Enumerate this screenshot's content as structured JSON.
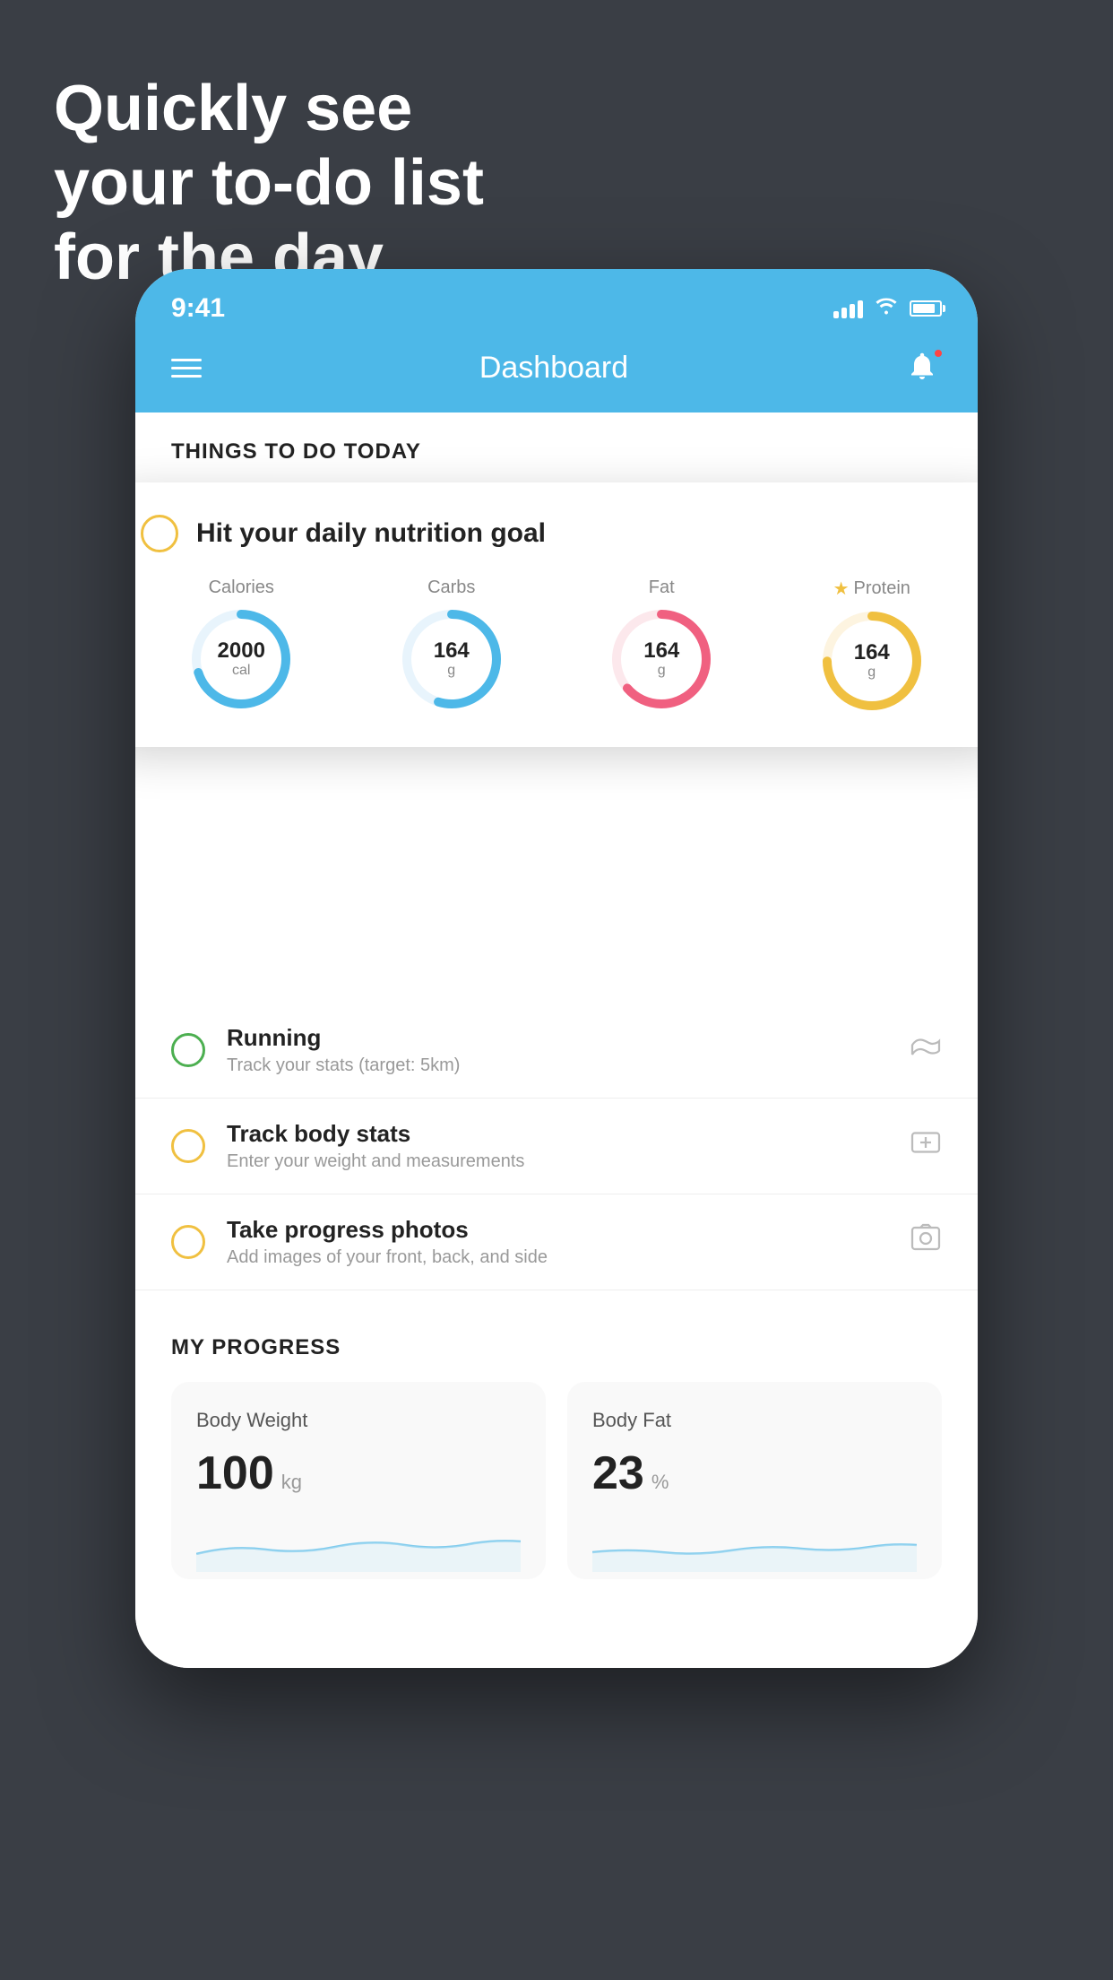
{
  "background": {
    "color": "#3a3e45"
  },
  "hero": {
    "line1": "Quickly see",
    "line2": "your to-do list",
    "line3": "for the day."
  },
  "phone": {
    "status_bar": {
      "time": "9:41",
      "signal": "signal-icon",
      "wifi": "wifi-icon",
      "battery": "battery-icon"
    },
    "header": {
      "menu_label": "menu-icon",
      "title": "Dashboard",
      "bell_label": "bell-icon"
    },
    "things_section": {
      "heading": "THINGS TO DO TODAY"
    },
    "floating_card": {
      "circle_color": "#f0c040",
      "title": "Hit your daily nutrition goal",
      "nutrition": [
        {
          "label": "Calories",
          "value": "2000",
          "unit": "cal",
          "color": "#4db8e8",
          "progress": 70,
          "starred": false
        },
        {
          "label": "Carbs",
          "value": "164",
          "unit": "g",
          "color": "#4db8e8",
          "progress": 55,
          "starred": false
        },
        {
          "label": "Fat",
          "value": "164",
          "unit": "g",
          "color": "#f06080",
          "progress": 65,
          "starred": false
        },
        {
          "label": "Protein",
          "value": "164",
          "unit": "g",
          "color": "#f0c040",
          "progress": 75,
          "starred": true
        }
      ]
    },
    "todo_items": [
      {
        "circle_color": "green",
        "title": "Running",
        "subtitle": "Track your stats (target: 5km)",
        "icon": "shoe-icon"
      },
      {
        "circle_color": "yellow",
        "title": "Track body stats",
        "subtitle": "Enter your weight and measurements",
        "icon": "scale-icon"
      },
      {
        "circle_color": "yellow",
        "title": "Take progress photos",
        "subtitle": "Add images of your front, back, and side",
        "icon": "photo-icon"
      }
    ],
    "progress_section": {
      "heading": "MY PROGRESS",
      "cards": [
        {
          "title": "Body Weight",
          "value": "100",
          "unit": "kg"
        },
        {
          "title": "Body Fat",
          "value": "23",
          "unit": "%"
        }
      ]
    }
  }
}
